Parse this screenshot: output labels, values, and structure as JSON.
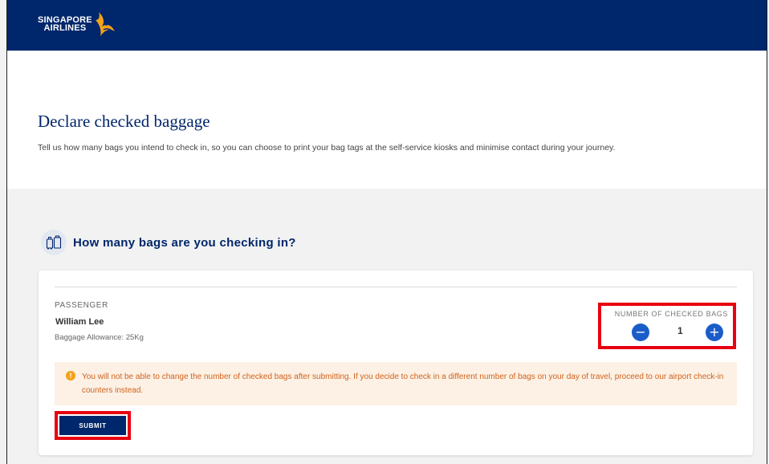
{
  "brand": {
    "line1": "SINGAPORE",
    "line2": "AIRLINES",
    "colors": {
      "navy": "#00266b",
      "gold": "#f3a21a",
      "highlight_red": "#e8000f",
      "stepper_blue": "#1a5cc8"
    }
  },
  "page": {
    "title": "Declare checked baggage",
    "description": "Tell us how many bags you intend to check in, so you can choose to print your bag tags at the self-service kiosks and minimise contact during your journey."
  },
  "section": {
    "icon": "luggage-icon",
    "title": "How many bags are you checking in?"
  },
  "passenger": {
    "label": "PASSENGER",
    "name": "William Lee",
    "allowance": "Baggage Allowance: 25Kg"
  },
  "bags": {
    "label": "NUMBER OF CHECKED BAGS",
    "count": "1",
    "minus_symbol": "−",
    "plus_symbol": "+"
  },
  "notice": {
    "icon": "warning-icon",
    "icon_glyph": "!",
    "text": "You will not be able to change the number of checked bags after submitting. If you decide to check in a different number of bags on your day of travel, proceed to our airport check-in counters instead."
  },
  "actions": {
    "submit_label": "SUBMIT"
  }
}
